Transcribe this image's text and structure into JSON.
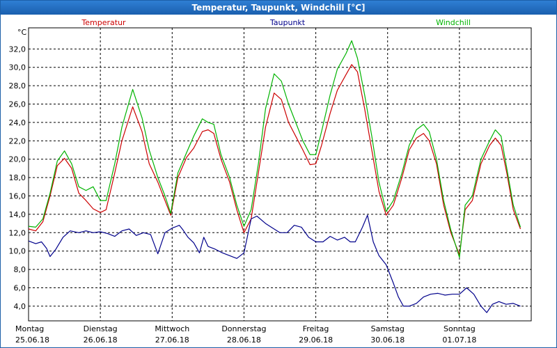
{
  "window": {
    "title": "Temperatur, Taupunkt, Windchill [°C]"
  },
  "chart_data": {
    "type": "line",
    "ylabel": "°C",
    "ylim": [
      2.4,
      34.3
    ],
    "yticks": [
      4,
      6,
      8,
      10,
      12,
      14,
      16,
      18,
      20,
      22,
      24,
      26,
      28,
      30,
      32
    ],
    "ytick_labels": [
      "4,0",
      "6,0",
      "8,0",
      "10,0",
      "12,0",
      "14,0",
      "16,0",
      "18,0",
      "20,0",
      "22,0",
      "24,0",
      "26,0",
      "28,0",
      "30,0",
      "32,0"
    ],
    "xlim": [
      0,
      7
    ],
    "x_ticks": [
      {
        "pos": 0,
        "day": "Montag",
        "date": "25.06.18"
      },
      {
        "pos": 1,
        "day": "Dienstag",
        "date": "26.06.18"
      },
      {
        "pos": 2,
        "day": "Mittwoch",
        "date": "27.06.18"
      },
      {
        "pos": 3,
        "day": "Donnerstag",
        "date": "28.06.18"
      },
      {
        "pos": 4,
        "day": "Freitag",
        "date": "29.06.18"
      },
      {
        "pos": 5,
        "day": "Samstag",
        "date": "30.06.18"
      },
      {
        "pos": 6,
        "day": "Sonntag",
        "date": "01.07.18"
      }
    ],
    "grid": true,
    "legend_position": "top",
    "series": [
      {
        "name": "Temperatur",
        "color": "#cc0000",
        "points": [
          [
            0.0,
            12.4
          ],
          [
            0.1,
            12.2
          ],
          [
            0.2,
            13.2
          ],
          [
            0.3,
            16.0
          ],
          [
            0.4,
            19.3
          ],
          [
            0.5,
            20.1
          ],
          [
            0.6,
            19.0
          ],
          [
            0.7,
            16.3
          ],
          [
            0.8,
            15.5
          ],
          [
            0.9,
            14.6
          ],
          [
            1.0,
            14.2
          ],
          [
            1.08,
            14.5
          ],
          [
            1.2,
            18.5
          ],
          [
            1.3,
            22.0
          ],
          [
            1.45,
            25.7
          ],
          [
            1.58,
            23.0
          ],
          [
            1.68,
            19.5
          ],
          [
            1.8,
            17.5
          ],
          [
            1.9,
            15.5
          ],
          [
            1.98,
            13.9
          ],
          [
            2.08,
            18.0
          ],
          [
            2.2,
            20.2
          ],
          [
            2.3,
            21.2
          ],
          [
            2.42,
            23.0
          ],
          [
            2.5,
            23.2
          ],
          [
            2.58,
            22.8
          ],
          [
            2.68,
            20.0
          ],
          [
            2.8,
            17.5
          ],
          [
            2.9,
            14.5
          ],
          [
            3.0,
            12.0
          ],
          [
            3.1,
            13.5
          ],
          [
            3.2,
            18.5
          ],
          [
            3.3,
            23.5
          ],
          [
            3.42,
            27.2
          ],
          [
            3.52,
            26.5
          ],
          [
            3.62,
            24.0
          ],
          [
            3.72,
            22.5
          ],
          [
            3.82,
            21.0
          ],
          [
            3.92,
            19.4
          ],
          [
            4.0,
            19.5
          ],
          [
            4.08,
            21.5
          ],
          [
            4.2,
            25.0
          ],
          [
            4.3,
            27.5
          ],
          [
            4.42,
            29.2
          ],
          [
            4.5,
            30.3
          ],
          [
            4.58,
            29.5
          ],
          [
            4.68,
            25.5
          ],
          [
            4.78,
            21.0
          ],
          [
            4.88,
            16.5
          ],
          [
            4.98,
            13.9
          ],
          [
            5.08,
            15.0
          ],
          [
            5.2,
            18.0
          ],
          [
            5.3,
            21.0
          ],
          [
            5.4,
            22.3
          ],
          [
            5.5,
            22.8
          ],
          [
            5.58,
            22.0
          ],
          [
            5.68,
            19.5
          ],
          [
            5.78,
            15.0
          ],
          [
            5.88,
            12.0
          ],
          [
            6.0,
            9.6
          ],
          [
            6.08,
            14.5
          ],
          [
            6.18,
            15.5
          ],
          [
            6.3,
            19.5
          ],
          [
            6.42,
            21.5
          ],
          [
            6.5,
            22.3
          ],
          [
            6.58,
            21.5
          ],
          [
            6.66,
            18.5
          ],
          [
            6.75,
            14.5
          ],
          [
            6.85,
            12.4
          ]
        ]
      },
      {
        "name": "Taupunkt",
        "color": "#00008b",
        "points": [
          [
            0.0,
            11.1
          ],
          [
            0.1,
            10.8
          ],
          [
            0.18,
            11.0
          ],
          [
            0.25,
            10.3
          ],
          [
            0.3,
            9.4
          ],
          [
            0.38,
            10.2
          ],
          [
            0.48,
            11.5
          ],
          [
            0.58,
            12.2
          ],
          [
            0.7,
            12.0
          ],
          [
            0.8,
            12.2
          ],
          [
            0.9,
            12.0
          ],
          [
            1.0,
            12.1
          ],
          [
            1.1,
            11.9
          ],
          [
            1.2,
            11.6
          ],
          [
            1.3,
            12.2
          ],
          [
            1.4,
            12.4
          ],
          [
            1.5,
            11.7
          ],
          [
            1.6,
            12.0
          ],
          [
            1.7,
            11.8
          ],
          [
            1.8,
            9.7
          ],
          [
            1.9,
            12.0
          ],
          [
            2.0,
            12.5
          ],
          [
            2.1,
            12.8
          ],
          [
            2.15,
            12.3
          ],
          [
            2.22,
            11.5
          ],
          [
            2.3,
            10.9
          ],
          [
            2.38,
            9.8
          ],
          [
            2.44,
            11.5
          ],
          [
            2.5,
            10.5
          ],
          [
            2.6,
            10.2
          ],
          [
            2.7,
            9.8
          ],
          [
            2.8,
            9.5
          ],
          [
            2.9,
            9.2
          ],
          [
            3.0,
            9.8
          ],
          [
            3.1,
            13.5
          ],
          [
            3.18,
            13.8
          ],
          [
            3.3,
            13.0
          ],
          [
            3.4,
            12.5
          ],
          [
            3.5,
            12.0
          ],
          [
            3.6,
            12.0
          ],
          [
            3.7,
            12.8
          ],
          [
            3.8,
            12.6
          ],
          [
            3.9,
            11.5
          ],
          [
            4.0,
            11.0
          ],
          [
            4.1,
            11.0
          ],
          [
            4.2,
            11.6
          ],
          [
            4.3,
            11.2
          ],
          [
            4.4,
            11.5
          ],
          [
            4.48,
            11.0
          ],
          [
            4.55,
            11.0
          ],
          [
            4.65,
            12.6
          ],
          [
            4.72,
            13.9
          ],
          [
            4.8,
            11.0
          ],
          [
            4.88,
            9.5
          ],
          [
            4.98,
            8.5
          ],
          [
            5.08,
            6.5
          ],
          [
            5.15,
            5.0
          ],
          [
            5.22,
            4.0
          ],
          [
            5.3,
            4.0
          ],
          [
            5.4,
            4.3
          ],
          [
            5.5,
            5.0
          ],
          [
            5.6,
            5.3
          ],
          [
            5.7,
            5.4
          ],
          [
            5.8,
            5.2
          ],
          [
            5.9,
            5.3
          ],
          [
            6.0,
            5.3
          ],
          [
            6.1,
            6.0
          ],
          [
            6.2,
            5.3
          ],
          [
            6.3,
            4.0
          ],
          [
            6.38,
            3.3
          ],
          [
            6.46,
            4.2
          ],
          [
            6.55,
            4.5
          ],
          [
            6.65,
            4.2
          ],
          [
            6.75,
            4.3
          ],
          [
            6.85,
            4.0
          ]
        ]
      },
      {
        "name": "Windchill",
        "color": "#00b300",
        "points": [
          [
            0.0,
            12.7
          ],
          [
            0.1,
            12.6
          ],
          [
            0.2,
            13.5
          ],
          [
            0.3,
            16.3
          ],
          [
            0.4,
            19.8
          ],
          [
            0.5,
            20.9
          ],
          [
            0.6,
            19.5
          ],
          [
            0.7,
            17.0
          ],
          [
            0.8,
            16.6
          ],
          [
            0.9,
            17.0
          ],
          [
            1.0,
            15.5
          ],
          [
            1.08,
            15.5
          ],
          [
            1.2,
            19.5
          ],
          [
            1.3,
            23.5
          ],
          [
            1.45,
            27.6
          ],
          [
            1.58,
            24.5
          ],
          [
            1.68,
            21.0
          ],
          [
            1.8,
            18.0
          ],
          [
            1.9,
            16.0
          ],
          [
            1.98,
            14.1
          ],
          [
            2.08,
            18.5
          ],
          [
            2.2,
            20.7
          ],
          [
            2.3,
            22.5
          ],
          [
            2.42,
            24.4
          ],
          [
            2.5,
            24.0
          ],
          [
            2.58,
            23.8
          ],
          [
            2.68,
            20.5
          ],
          [
            2.8,
            18.0
          ],
          [
            2.9,
            15.0
          ],
          [
            3.0,
            12.7
          ],
          [
            3.1,
            14.5
          ],
          [
            3.2,
            19.5
          ],
          [
            3.3,
            25.5
          ],
          [
            3.42,
            29.3
          ],
          [
            3.52,
            28.5
          ],
          [
            3.62,
            26.0
          ],
          [
            3.72,
            24.0
          ],
          [
            3.82,
            22.0
          ],
          [
            3.92,
            20.5
          ],
          [
            4.0,
            20.5
          ],
          [
            4.08,
            23.0
          ],
          [
            4.2,
            27.0
          ],
          [
            4.3,
            29.8
          ],
          [
            4.42,
            31.5
          ],
          [
            4.5,
            32.9
          ],
          [
            4.58,
            31.0
          ],
          [
            4.68,
            27.0
          ],
          [
            4.78,
            22.5
          ],
          [
            4.88,
            17.5
          ],
          [
            4.98,
            14.3
          ],
          [
            5.08,
            15.5
          ],
          [
            5.2,
            18.5
          ],
          [
            5.3,
            21.5
          ],
          [
            5.4,
            23.2
          ],
          [
            5.5,
            23.8
          ],
          [
            5.58,
            23.0
          ],
          [
            5.68,
            20.0
          ],
          [
            5.78,
            15.5
          ],
          [
            5.88,
            12.3
          ],
          [
            6.0,
            9.3
          ],
          [
            6.08,
            15.0
          ],
          [
            6.18,
            16.0
          ],
          [
            6.3,
            20.0
          ],
          [
            6.42,
            22.0
          ],
          [
            6.5,
            23.2
          ],
          [
            6.58,
            22.5
          ],
          [
            6.66,
            19.0
          ],
          [
            6.75,
            15.0
          ],
          [
            6.85,
            12.6
          ]
        ]
      }
    ]
  }
}
